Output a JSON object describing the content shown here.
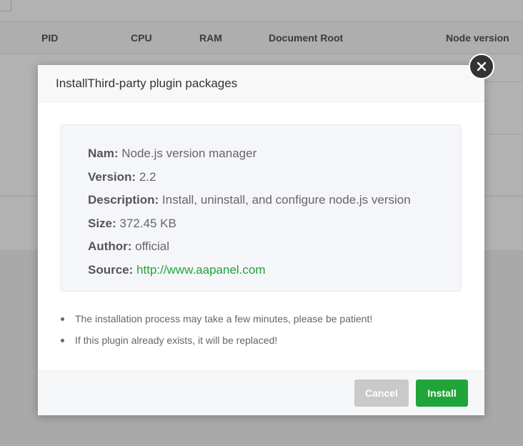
{
  "background": {
    "table_headers": [
      "PID",
      "CPU",
      "RAM",
      "Document Root",
      "Node version"
    ]
  },
  "dialog": {
    "title": "InstallThird-party plugin packages",
    "info": {
      "name_label": "Nam:",
      "name_value": "Node.js version manager",
      "version_label": "Version:",
      "version_value": "2.2",
      "description_label": "Description:",
      "description_value": "Install, uninstall, and configure node.js version",
      "size_label": "Size:",
      "size_value": "372.45 KB",
      "author_label": "Author:",
      "author_value": "official",
      "source_label": "Source:",
      "source_value": "http://www.aapanel.com"
    },
    "notes": [
      "The installation process may take a few minutes, please be patient!",
      "If this plugin already exists, it will be replaced!"
    ],
    "buttons": {
      "cancel": "Cancel",
      "install": "Install"
    }
  },
  "colors": {
    "accent": "#20a53a",
    "cancel": "#c9c9c9",
    "overlay": "rgba(0,0,0,0.30)"
  },
  "icons": {
    "close": "close-icon"
  }
}
